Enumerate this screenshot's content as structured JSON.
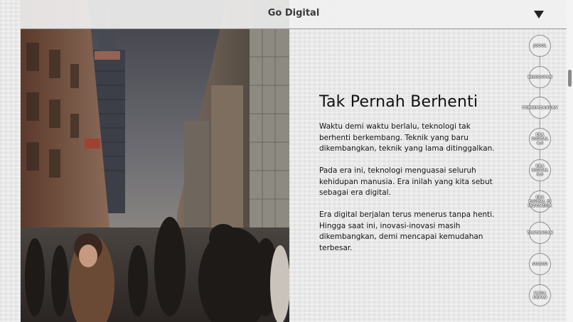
{
  "header": {
    "title": "Go Digital",
    "menu_icon": "caret-down-icon"
  },
  "content": {
    "heading": "Tak Pernah Berhenti",
    "paragraphs": [
      "Waktu demi waktu berlalu, teknologi tak berhenti berkembang. Teknik yang baru dikembangkan, teknik yang lama ditinggalkan.",
      "Pada era ini, teknologi menguasai seluruh kehidupan manusia. Era inilah yang kita sebut sebagai era digital.",
      "Era digital berjalan terus menerus tanpa henti. Hingga saat ini, inovasi-inovasi masih dikembangkan, demi mencapai kemudahan terbesar."
    ]
  },
  "nav": {
    "items": [
      {
        "label": "JUDUL"
      },
      {
        "label": "KEHIDUPAN"
      },
      {
        "label": "PERKEMBANGAN"
      },
      {
        "label": "ERA\nDIGITAL\n4.0"
      },
      {
        "label": "ERA\nDIGITAL\n5.0"
      },
      {
        "label": "ERA\nDIGITAL DI\nINDONESIA"
      },
      {
        "label": "TANTANGAN"
      },
      {
        "label": "SOLUSI"
      },
      {
        "label": "MASA\nDEPAN"
      }
    ]
  },
  "colors": {
    "background": "#e9e9e9",
    "text": "#151515",
    "nav_border": "#8f8f8f"
  }
}
